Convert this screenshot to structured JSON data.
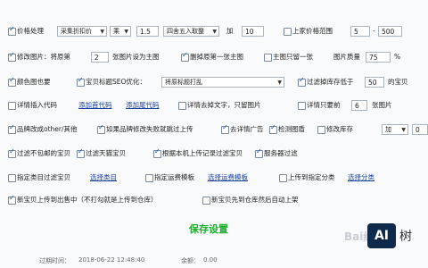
{
  "row1": {
    "price_label": "价格处理",
    "mode": "采集折扣价",
    "op": "乘",
    "factor": "1.5",
    "round": "四舍五入取整",
    "add_label": "加",
    "add_value": "10",
    "range_label": "上家价格范围",
    "range_min": "5",
    "range_sep": "-",
    "range_max": "500"
  },
  "row2": {
    "modify_label": "修改图片：将原第",
    "num": "2",
    "suffix": "张图片设为主图",
    "delete_label": "删掉原第一张主图",
    "keep_one": "主图只留一张",
    "quality_label": "图片质量",
    "quality_value": "75",
    "quality_pct": "%"
  },
  "row3": {
    "color_label": "颜色图也要",
    "seo_label": "宝贝标题SEO优化：",
    "seo_value": "将原标题打乱",
    "filter_label": "过滤掉库存低于",
    "filter_value": "50",
    "filter_suffix": "的宝贝"
  },
  "row4": {
    "detail_insert": "详情插入代码",
    "add_head": "添加首代码",
    "add_tail": "添加尾代码",
    "remove_text": "详情去掉文字，只留图片",
    "keep_only": "详情只要前",
    "keep_num": "6",
    "keep_suffix": "张图片"
  },
  "row5": {
    "brand_other": "品牌改成other/其他",
    "brand_fail": "如果品牌修改失败就跳过上传",
    "remove_ads": "去详情广告",
    "detect_img": "检测图盾",
    "stock_label": "修改库存",
    "stock_op": "加",
    "stock_value": "0"
  },
  "row6": {
    "free_ship": "过滤不包邮的宝贝",
    "tmall": "过滤天猫宝贝",
    "local_filter": "根据本机上传记录过滤宝贝",
    "server_filter": "服务器过滤"
  },
  "row7": {
    "category_filter": "指定类目过滤宝贝",
    "choose_category": "选择类目",
    "template": "指定运费模板",
    "choose_template": "选择运费模板",
    "upload_category": "上传到指定分类",
    "choose_category2": "选择分类"
  },
  "row8": {
    "new_sale": "新宝贝上传到出售中（不打勾就是上传到仓库）",
    "new_first": "新宝贝先到仓库然后自动上架"
  },
  "save_label": "保存设置",
  "footer": {
    "expire_label": "过期时间：",
    "expire_value": "2018-06-22 12:48:40",
    "balance_label": "余额：",
    "balance_value": "0.00"
  },
  "watermark": {
    "brand": "Bai经验",
    "badge": "AI",
    "side": "树"
  }
}
